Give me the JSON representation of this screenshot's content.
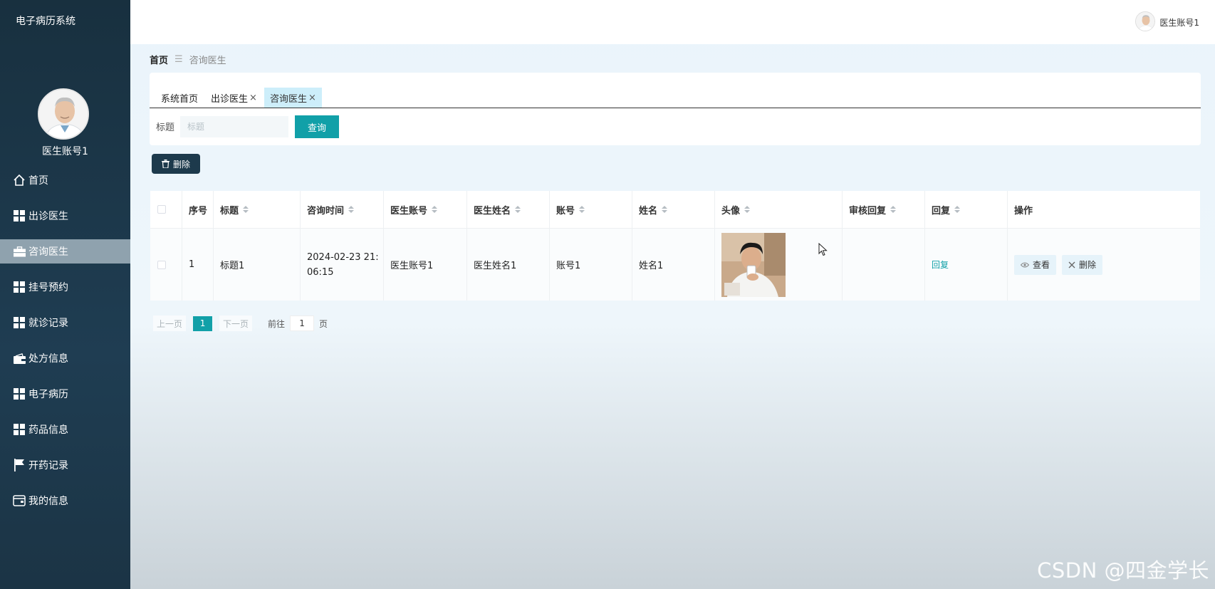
{
  "app": {
    "title": "电子病历系统"
  },
  "sidebar": {
    "username": "医生账号1",
    "items": [
      {
        "label": "首页",
        "icon": "home-icon"
      },
      {
        "label": "出诊医生",
        "icon": "grid-icon"
      },
      {
        "label": "咨询医生",
        "icon": "briefcase-icon",
        "active": true
      },
      {
        "label": "挂号预约",
        "icon": "grid-icon"
      },
      {
        "label": "就诊记录",
        "icon": "grid-icon"
      },
      {
        "label": "处方信息",
        "icon": "wallet-icon"
      },
      {
        "label": "电子病历",
        "icon": "grid-icon"
      },
      {
        "label": "药品信息",
        "icon": "grid-icon"
      },
      {
        "label": "开药记录",
        "icon": "flag-icon"
      },
      {
        "label": "我的信息",
        "icon": "card-icon"
      }
    ]
  },
  "header": {
    "username": "医生账号1"
  },
  "breadcrumb": {
    "home": "首页",
    "separator": "☰",
    "current": "咨询医生"
  },
  "tabs": [
    {
      "label": "系统首页"
    },
    {
      "label": "出诊医生",
      "close": "×"
    },
    {
      "label": "咨询医生",
      "close": "×",
      "active": true
    }
  ],
  "search": {
    "label": "标题",
    "placeholder": "标题",
    "button": "查询"
  },
  "toolbar": {
    "delete_label": "删除"
  },
  "table": {
    "columns": [
      "序号",
      "标题",
      "咨询时间",
      "医生账号",
      "医生姓名",
      "账号",
      "姓名",
      "头像",
      "审核回复",
      "回复",
      "操作"
    ],
    "rows": [
      {
        "index": "1",
        "title": "标题1",
        "time_line1": "2024-02-23 21:",
        "time_line2": "06:15",
        "doctor_account": "医生账号1",
        "doctor_name": "医生姓名1",
        "account": "账号1",
        "name": "姓名1",
        "review_reply": "",
        "reply": "回复",
        "view": "查看",
        "delete": "删除"
      }
    ]
  },
  "pagination": {
    "prev": "上一页",
    "current": "1",
    "next": "下一页",
    "goto": "前往",
    "page_value": "1",
    "unit": "页"
  },
  "watermark": "CSDN @四金学长",
  "colors": {
    "sidebar": "#1f3d52",
    "accent": "#11a0a8",
    "active_menu": "#8fa2ae",
    "active_tab": "#cdeefa"
  }
}
